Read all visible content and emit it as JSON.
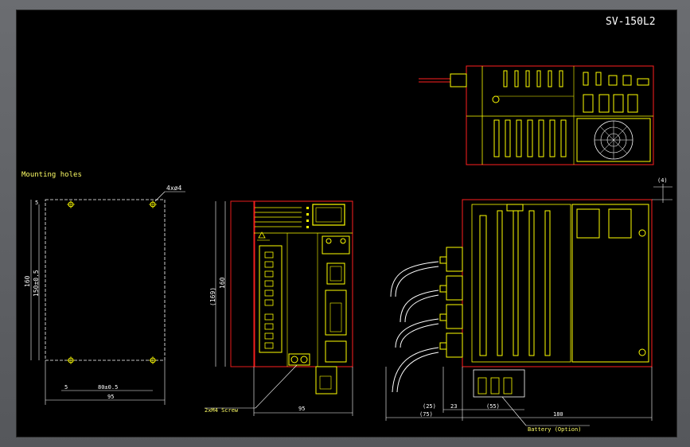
{
  "drawing": {
    "title": "SV-150L2",
    "colors": {
      "background": "#000000",
      "frame": "#5d5f63",
      "outline": "#ffff00",
      "body": "#ff2020",
      "dimension": "#ffffff",
      "note": "#ffff66"
    }
  },
  "mounting_view": {
    "caption": "Mounting holes",
    "hole_callout": "4xø4",
    "dim_height_outer": "160",
    "dim_height_inner": "150±0.5",
    "dim_top": "5",
    "dim_bottom_left": "5",
    "dim_width_inner": "80±0.5",
    "dim_width_outer": "95"
  },
  "front_view": {
    "dim_height_total": "(169)",
    "dim_height_body": "160",
    "dim_width": "95",
    "screw_callout": "2xM4 Screw"
  },
  "side_view": {
    "dim_top_offset": "(4)",
    "dim_connector": "(25)",
    "dim_23": "23",
    "dim_battery": "(55)",
    "dim_cable": "(75)",
    "dim_depth": "180",
    "battery_callout": "Battery (Option)"
  }
}
